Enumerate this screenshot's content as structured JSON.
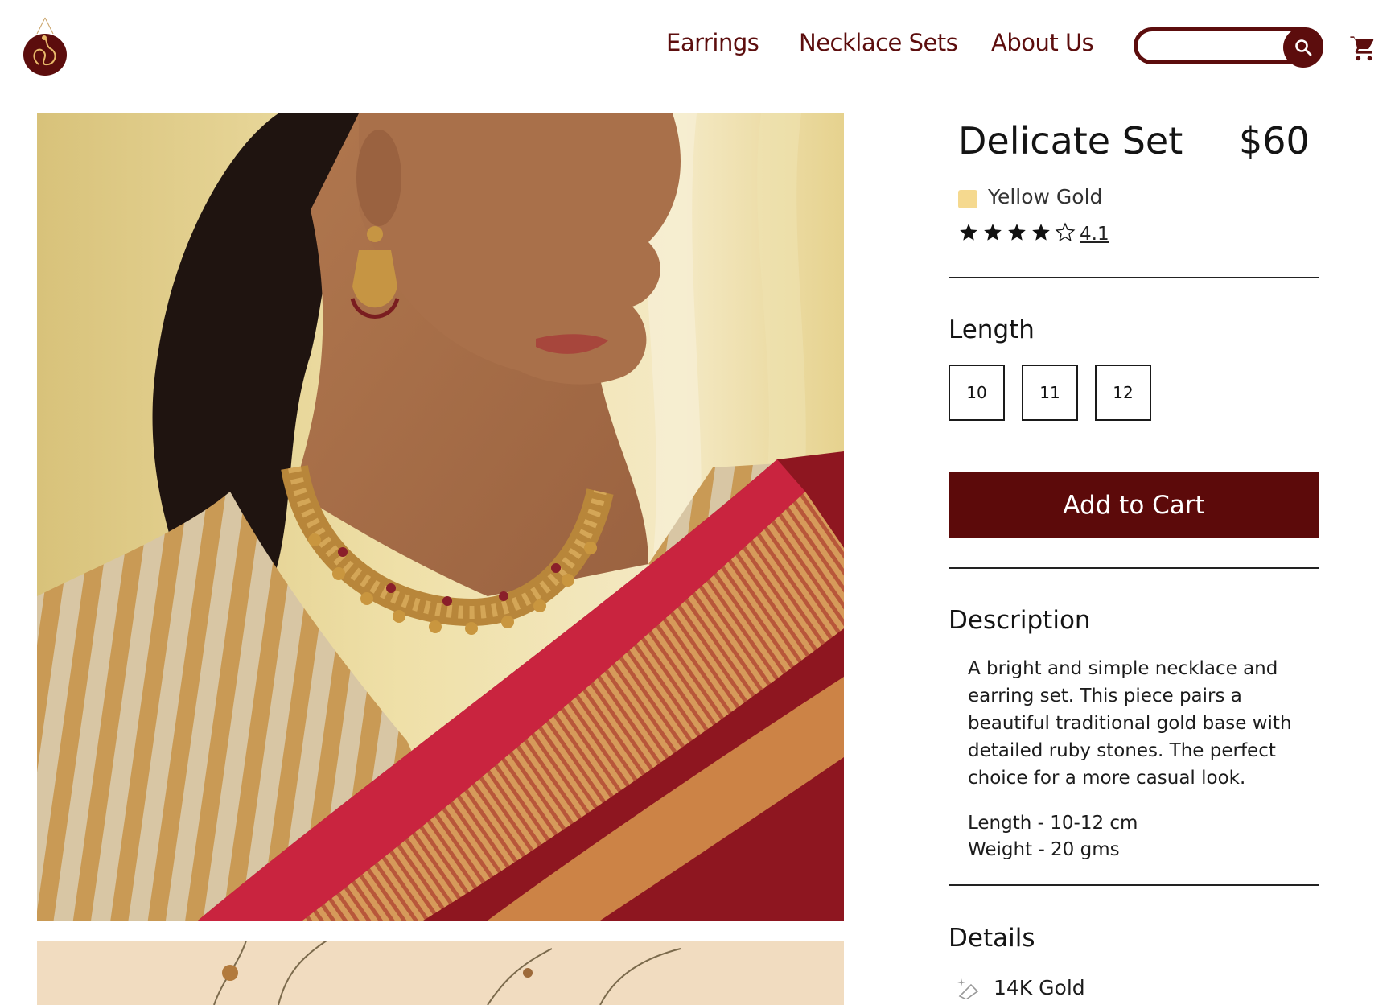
{
  "nav": {
    "links": [
      "Earrings",
      "Necklace Sets",
      "About Us"
    ]
  },
  "search": {
    "placeholder": "",
    "value": ""
  },
  "product": {
    "title": "Delicate Set",
    "price": "$60",
    "color": {
      "name": "Yellow Gold",
      "swatch": "#f5d98f"
    },
    "rating": {
      "value": "4.1",
      "stars_filled": 4,
      "stars_total": 5
    },
    "length": {
      "label": "Length",
      "options": [
        "10",
        "11",
        "12"
      ]
    },
    "add_to_cart": "Add to Cart",
    "description": {
      "label": "Description",
      "text": "A bright and simple necklace and earring set. This piece pairs a beautiful traditional gold base with detailed ruby stones. The perfect choice for a more casual look.",
      "length_spec": "Length - 10-12 cm",
      "weight_spec": "Weight - 20 gms"
    },
    "details": {
      "label": "Details",
      "items": [
        "14K Gold"
      ]
    }
  },
  "colors": {
    "brand": "#5c0d0d",
    "button": "#5c0a0a"
  }
}
